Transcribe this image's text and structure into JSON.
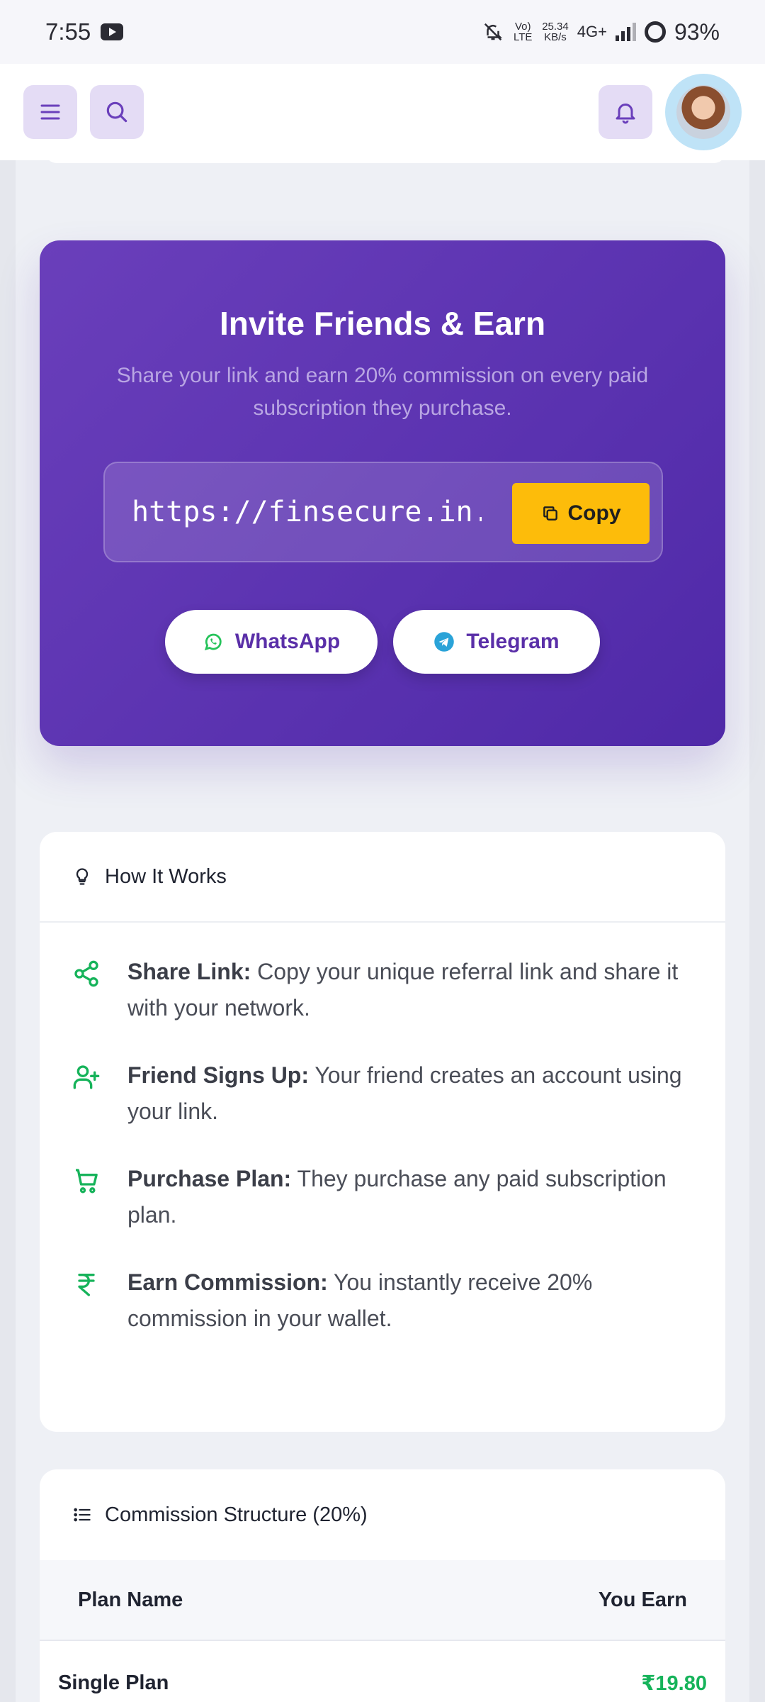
{
  "status_bar": {
    "time": "7:55",
    "volte": "Vo) LTE",
    "speed_value": "25.34",
    "speed_unit": "KB/s",
    "network": "4G+",
    "battery": "93%"
  },
  "header": {
    "menu_icon": "menu-icon",
    "search_icon": "search-icon",
    "bell_icon": "bell-icon",
    "avatar": "user-avatar"
  },
  "invite": {
    "title": "Invite Friends & Earn",
    "subtitle": "Share your link and earn 20% commission on every paid subscription they purchase.",
    "link_value": "https://finsecure.in.n",
    "copy_label": "Copy",
    "whatsapp_label": "WhatsApp",
    "telegram_label": "Telegram",
    "colors": {
      "card": "#5a31ad",
      "copy_button": "#fdbc0a",
      "share_text": "#5a2fa8"
    }
  },
  "how_it_works": {
    "title": "How It Works",
    "steps": [
      {
        "icon": "share-icon",
        "bold": "Share Link:",
        "text": " Copy your unique referral link and share it with your network."
      },
      {
        "icon": "user-plus-icon",
        "bold": "Friend Signs Up:",
        "text": " Your friend creates an account using your link."
      },
      {
        "icon": "cart-icon",
        "bold": "Purchase Plan:",
        "text": " They purchase any paid subscription plan."
      },
      {
        "icon": "rupee-icon",
        "bold": "Earn Commission:",
        "text": " You instantly receive 20% commission in your wallet."
      }
    ],
    "accent": "#16b35a"
  },
  "commission": {
    "title": "Commission Structure (20%)",
    "columns": [
      "Plan Name",
      "You Earn"
    ],
    "rows": [
      {
        "plan": "Single Plan",
        "earn": "₹19.80"
      }
    ]
  }
}
